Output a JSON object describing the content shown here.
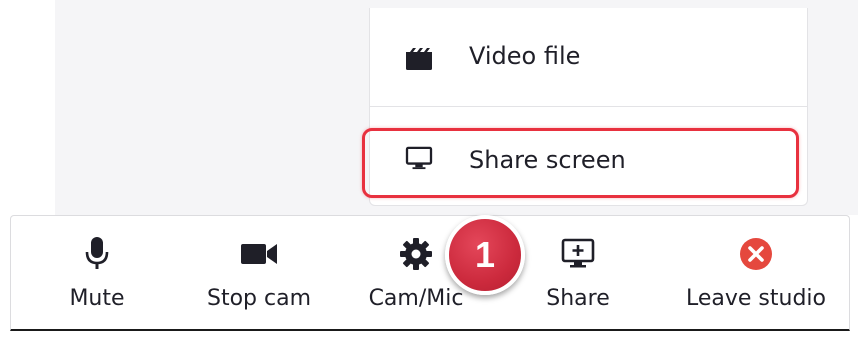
{
  "menu": {
    "items": [
      {
        "label": "Video file",
        "icon": "clapperboard-icon"
      },
      {
        "label": "Share screen",
        "icon": "monitor-icon"
      }
    ]
  },
  "toolbar": {
    "buttons": [
      {
        "label": "Mute",
        "icon": "microphone-icon"
      },
      {
        "label": "Stop cam",
        "icon": "video-camera-icon"
      },
      {
        "label": "Cam/Mic",
        "icon": "gear-icon"
      },
      {
        "label": "Share",
        "icon": "screen-share-icon"
      },
      {
        "label": "Leave studio",
        "icon": "close-circle-icon"
      }
    ]
  },
  "annotation": {
    "step": "1"
  },
  "colors": {
    "accent_red": "#e8313f",
    "leave_red": "#e5483e",
    "text": "#1f1f28"
  }
}
